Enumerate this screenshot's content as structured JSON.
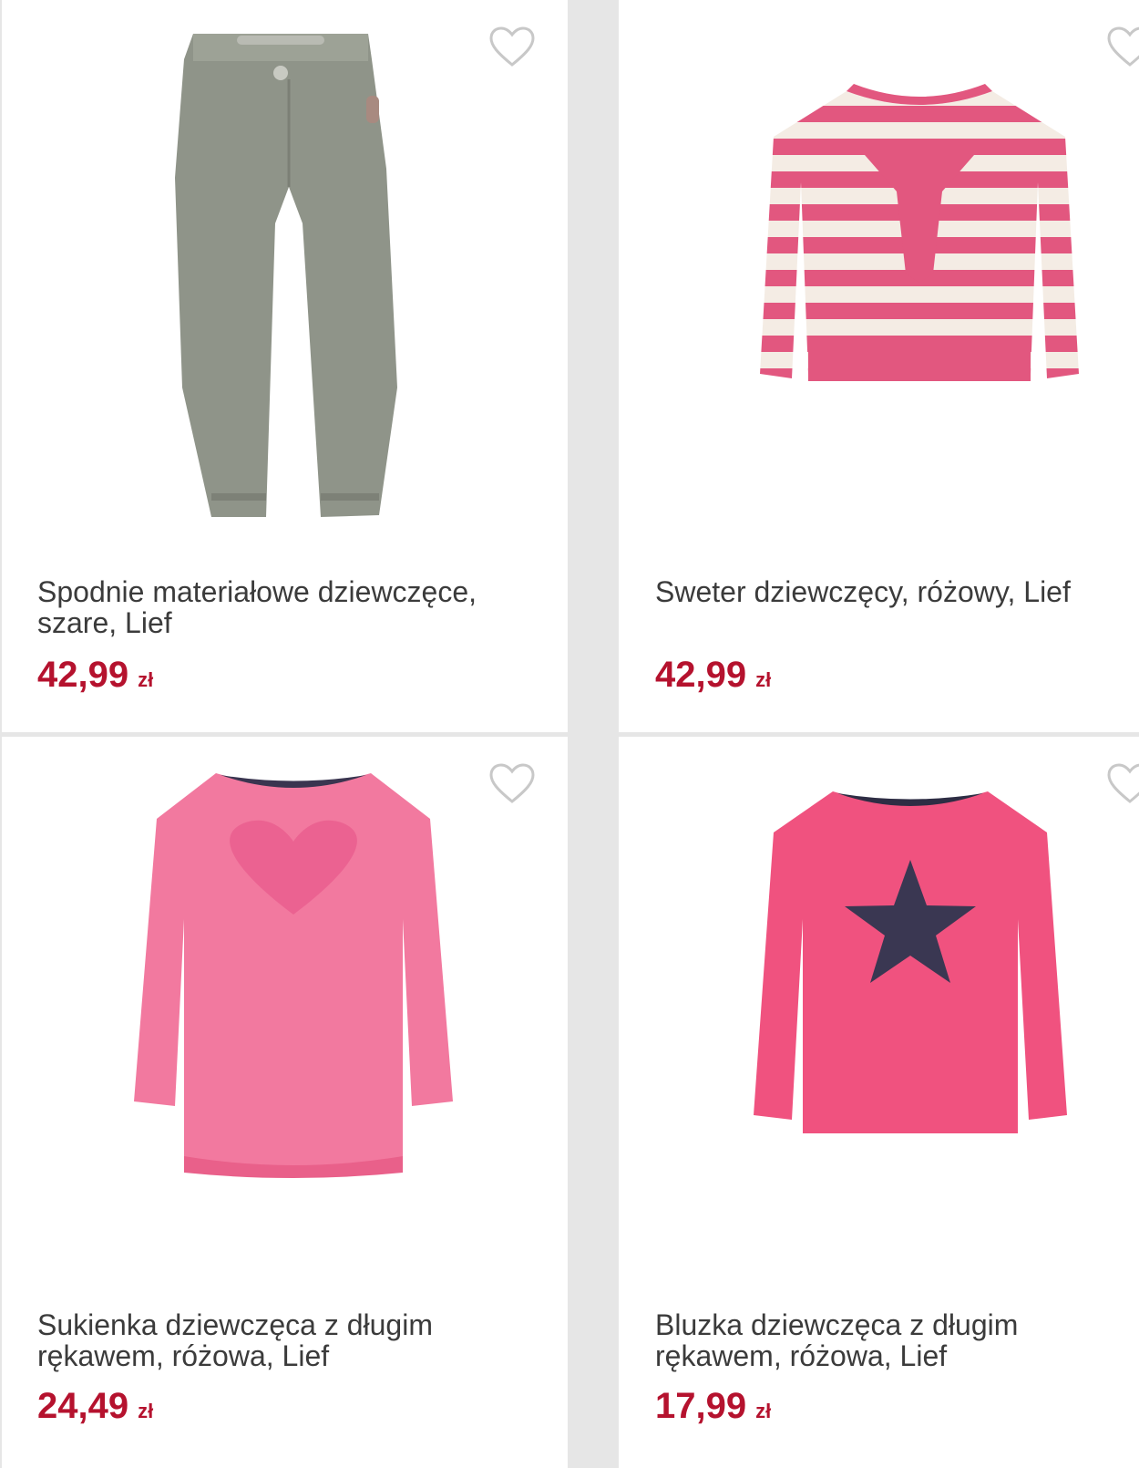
{
  "products": [
    {
      "title": "Spodnie materiałowe dziewczęce, szare, Lief",
      "price": "42,99",
      "currency": "zł",
      "image": "grey-trousers"
    },
    {
      "title": "Sweter dziewczęcy, różowy, Lief",
      "price": "42,99",
      "currency": "zł",
      "image": "pink-striped-sweater"
    },
    {
      "title": "Sukienka dziewczęca z długim rękawem, różowa, Lief",
      "price": "24,49",
      "currency": "zł",
      "image": "pink-heart-dress"
    },
    {
      "title": "Bluzka dziewczęca z długim rękawem, różowa, Lief",
      "price": "17,99",
      "currency": "zł",
      "image": "pink-star-blouse"
    }
  ],
  "colors": {
    "price": "#b5122e",
    "title": "#3b3b3b",
    "heart": "#c8c8c8",
    "background": "#e6e6e6"
  },
  "icons": {
    "favorite": "heart-outline-icon"
  }
}
